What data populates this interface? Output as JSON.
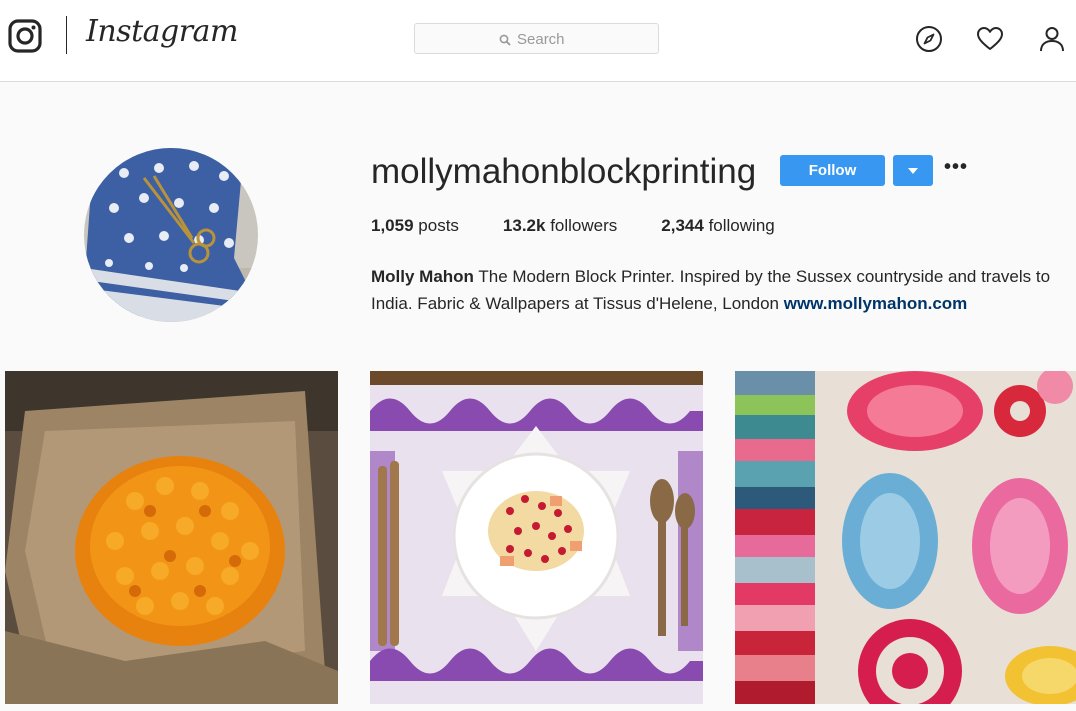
{
  "header": {
    "wordmark": "Instagram",
    "search_placeholder": "Search",
    "icons": [
      "instagram-logo-icon",
      "search-icon",
      "compass-icon",
      "heart-icon",
      "user-icon"
    ]
  },
  "profile": {
    "username": "mollymahonblockprinting",
    "follow_label": "Follow",
    "more_label": "•••",
    "stats": [
      {
        "count": "1,059",
        "label": "posts"
      },
      {
        "count": "13.2k",
        "label": "followers"
      },
      {
        "count": "2,344",
        "label": "following"
      }
    ],
    "bio_name": "Molly Mahon",
    "bio_text": "The Modern Block Printer. Inspired by the Sussex countryside and travels to India. Fabric & Wallpapers at Tissus d'Helene, London",
    "bio_link": "www.mollymahon.com"
  },
  "colors": {
    "accent": "#3897f0",
    "link": "#003569",
    "text": "#262626",
    "background": "#fafafa"
  }
}
